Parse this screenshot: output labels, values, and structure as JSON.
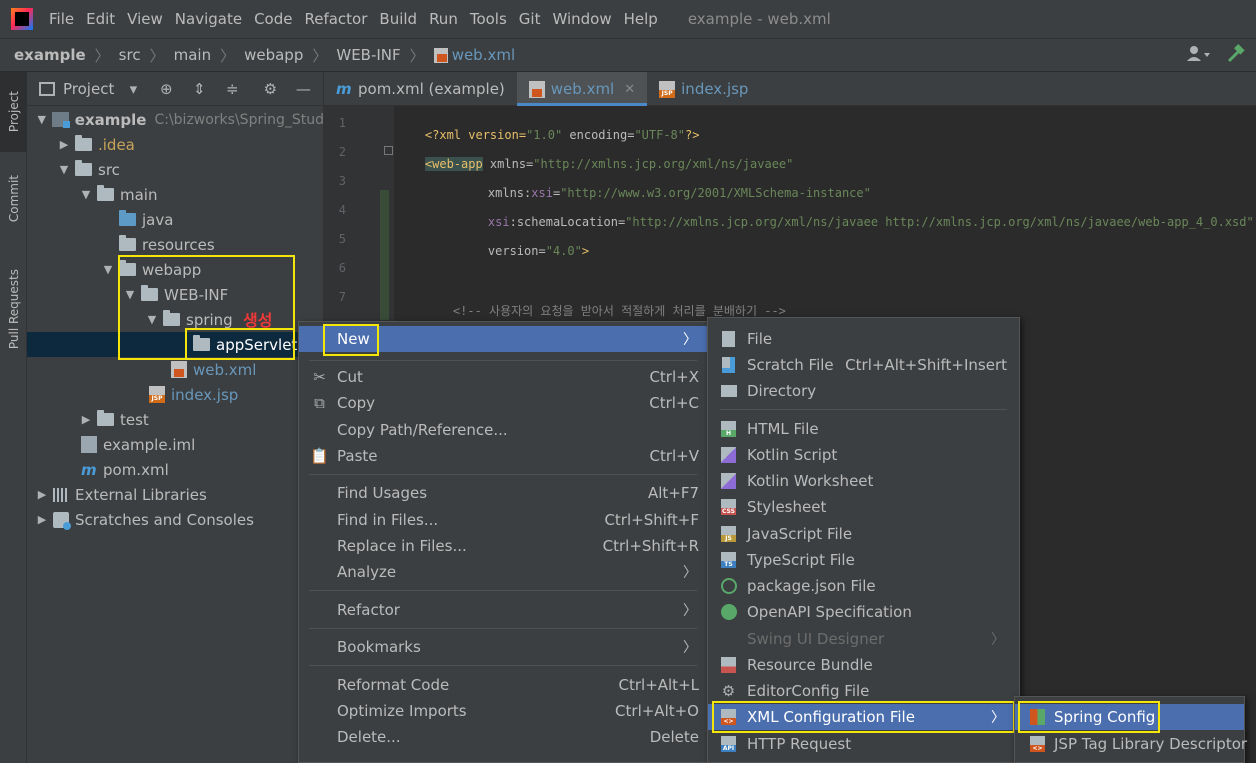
{
  "menubar": {
    "items": [
      "File",
      "Edit",
      "View",
      "Navigate",
      "Code",
      "Refactor",
      "Build",
      "Run",
      "Tools",
      "Git",
      "Window",
      "Help"
    ],
    "window_title": "example - web.xml"
  },
  "breadcrumb": [
    "example",
    "src",
    "main",
    "webapp",
    "WEB-INF",
    "web.xml"
  ],
  "left_strip": {
    "project": "Project",
    "commit": "Commit",
    "pull_requests": "Pull Requests"
  },
  "project_panel": {
    "title": "Project",
    "tree": {
      "root_name": "example",
      "root_path": "C:\\bizworks\\Spring_Stud",
      "idea": ".idea",
      "src": "src",
      "main": "main",
      "java": "java",
      "resources": "resources",
      "webapp": "webapp",
      "webinf": "WEB-INF",
      "spring": "spring",
      "appservlet": "appServlet",
      "webxml": "web.xml",
      "indexjsp": "index.jsp",
      "test": "test",
      "exampleiml": "example.iml",
      "pomxml": "pom.xml",
      "external_libraries": "External Libraries",
      "scratches": "Scratches and Consoles"
    },
    "annotation": "생성"
  },
  "editor": {
    "tabs": [
      {
        "label": "pom.xml (example)"
      },
      {
        "label": "web.xml"
      },
      {
        "label": "index.jsp"
      }
    ],
    "line_numbers": [
      "1",
      "2",
      "3",
      "4",
      "5",
      "6",
      "7"
    ],
    "code": {
      "l1_a": "<?xml version=",
      "l1_b": "\"1.0\"",
      "l1_c": " encoding=",
      "l1_d": "\"UTF-8\"",
      "l1_e": "?>",
      "l2_tag": "<web-app",
      "l2_attr": " xmlns=",
      "l2_val": "\"http://xmlns.jcp.org/xml/ns/javaee\"",
      "l3_ns": "xmlns:",
      "l3_attr": "xsi",
      "l3_eq": "=",
      "l3_val": "\"http://www.w3.org/2001/XMLSchema-instance\"",
      "l4_ns": "xsi",
      "l4_attr": ":schemaLocation=",
      "l4_val": "\"http://xmlns.jcp.org/xml/ns/javaee http://xmlns.jcp.org/xml/ns/javaee/web-app_4_0.xsd\"",
      "l5_attr": "version=",
      "l5_val": "\"4.0\"",
      "l5_end": ">",
      "l7_comment": "<!-- 사용자의 요청을 받아서 적절하게 처리를 분배하기 -->"
    }
  },
  "context_menu": {
    "new": "New",
    "cut": {
      "label": "Cut",
      "shortcut": "Ctrl+X"
    },
    "copy": {
      "label": "Copy",
      "shortcut": "Ctrl+C"
    },
    "copy_path": {
      "label": "Copy Path/Reference..."
    },
    "paste": {
      "label": "Paste",
      "shortcut": "Ctrl+V"
    },
    "find_usages": {
      "label": "Find Usages",
      "shortcut": "Alt+F7"
    },
    "find_in_files": {
      "label": "Find in Files...",
      "shortcut": "Ctrl+Shift+F"
    },
    "replace_in_files": {
      "label": "Replace in Files...",
      "shortcut": "Ctrl+Shift+R"
    },
    "analyze": {
      "label": "Analyze"
    },
    "refactor": {
      "label": "Refactor"
    },
    "bookmarks": {
      "label": "Bookmarks"
    },
    "reformat": {
      "label": "Reformat Code",
      "shortcut": "Ctrl+Alt+L"
    },
    "optimize": {
      "label": "Optimize Imports",
      "shortcut": "Ctrl+Alt+O"
    },
    "delete": {
      "label": "Delete...",
      "shortcut": "Delete"
    }
  },
  "new_submenu": {
    "file": "File",
    "scratch": {
      "label": "Scratch File",
      "shortcut": "Ctrl+Alt+Shift+Insert"
    },
    "directory": "Directory",
    "html": "HTML File",
    "kotlin_script": "Kotlin Script",
    "kotlin_worksheet": "Kotlin Worksheet",
    "stylesheet": "Stylesheet",
    "javascript": "JavaScript File",
    "typescript": "TypeScript File",
    "package_json": "package.json File",
    "openapi": "OpenAPI Specification",
    "swing": "Swing UI Designer",
    "resource_bundle": "Resource Bundle",
    "editorconfig": "EditorConfig File",
    "xml_config": "XML Configuration File",
    "http_request": "HTTP Request"
  },
  "xml_submenu": {
    "spring_config": "Spring Config",
    "jsp_tag": "JSP Tag Library Descriptor"
  },
  "colors": {
    "highlight_box": "#f5e60a",
    "menu_selected": "#4b6eaf",
    "annotation_red": "#f03838"
  }
}
